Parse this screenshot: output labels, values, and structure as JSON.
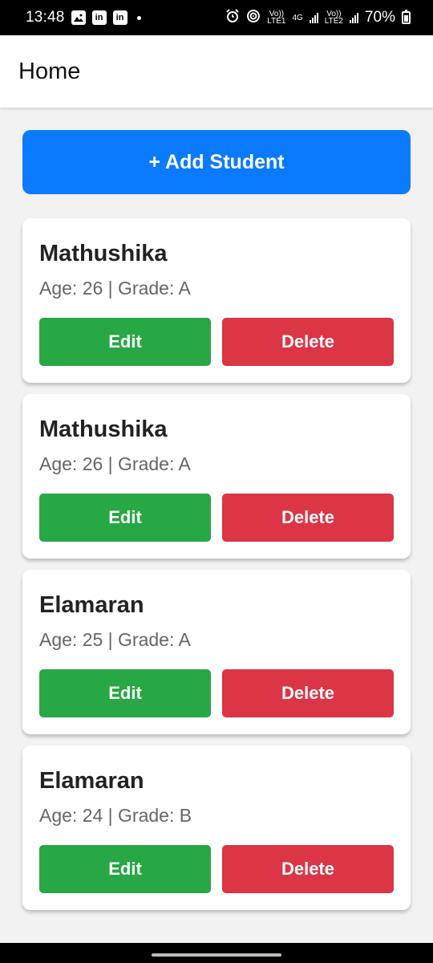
{
  "status_bar": {
    "time": "13:48",
    "left_icons": [
      "gallery-icon",
      "linkedin-icon",
      "linkedin-icon",
      "notification-dot-icon"
    ],
    "net1_top": "Vo))",
    "net1_bottom": "LTE1",
    "net_type": "4G",
    "net2_top": "Vo))",
    "net2_bottom": "LTE2",
    "battery": "70%"
  },
  "header": {
    "title": "Home"
  },
  "actions": {
    "add_label": "+ Add Student"
  },
  "students": [
    {
      "name": "Mathushika",
      "info": "Age: 26 | Grade: A",
      "edit_label": "Edit",
      "delete_label": "Delete"
    },
    {
      "name": "Mathushika",
      "info": "Age: 26 | Grade: A",
      "edit_label": "Edit",
      "delete_label": "Delete"
    },
    {
      "name": "Elamaran",
      "info": "Age: 25 | Grade: A",
      "edit_label": "Edit",
      "delete_label": "Delete"
    },
    {
      "name": "Elamaran",
      "info": "Age: 24 | Grade: B",
      "edit_label": "Edit",
      "delete_label": "Delete"
    }
  ],
  "colors": {
    "primary": "#0a7bff",
    "edit": "#28a745",
    "delete": "#dc3545",
    "background": "#f2f2f2"
  }
}
